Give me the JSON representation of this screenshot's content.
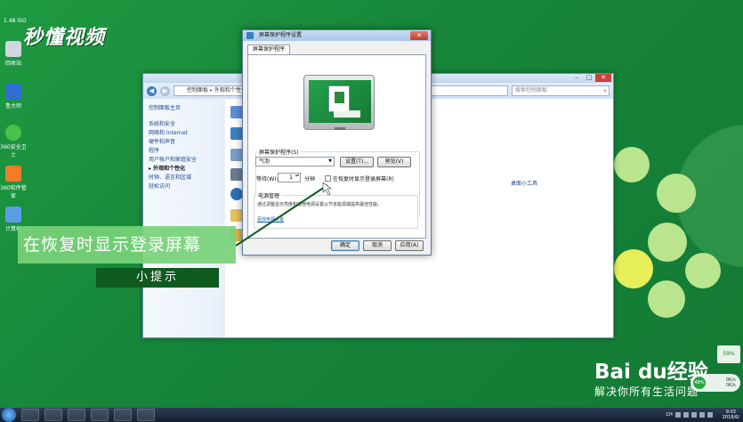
{
  "watermark": "秒懂视频",
  "top_number": "1.48 ISO",
  "desktop_icons": [
    {
      "name": "recycle-bin",
      "label": "回收站",
      "color": "#cfd8e0"
    },
    {
      "name": "app-2",
      "label": "鲁大师",
      "color": "#2f6fd1"
    },
    {
      "name": "app-3",
      "label": "360安全卫士",
      "color": "#49c14a"
    },
    {
      "name": "app-4",
      "label": "360软件管家",
      "color": "#f47b2a"
    },
    {
      "name": "app-5",
      "label": "计算机",
      "color": "#5c9ee6"
    }
  ],
  "control_panel": {
    "address": [
      "控制面板",
      "外观和个性化"
    ],
    "search_placeholder": "搜索控制面板",
    "left_nav": [
      {
        "label": "控制面板主页",
        "head": true
      },
      {
        "label": "系统和安全"
      },
      {
        "label": "网络和 Internet"
      },
      {
        "label": "硬件和声音"
      },
      {
        "label": "程序"
      },
      {
        "label": "用户帐户和家庭安全"
      },
      {
        "label": "外观和个性化",
        "current": true
      },
      {
        "label": "时钟、语言和区域"
      },
      {
        "label": "轻松访问"
      }
    ],
    "right_link": "桌面小工具"
  },
  "dialog": {
    "title": "屏幕保护程序设置",
    "close": "✕",
    "tab": "屏幕保护程序",
    "screensaver_group_label": "屏幕保护程序(S)",
    "screensaver_value": "气泡",
    "settings_button": "设置(T)...",
    "preview_button": "预览(V)",
    "wait_label": "等待(W):",
    "wait_value": "1",
    "wait_unit": "分钟",
    "resume_checkbox_label": "在恢复时显示登录屏幕(R)",
    "power_group_label": "电源管理",
    "power_desc": "通过调整显示亮度和其他电源设置以节省能源或提供最佳性能。",
    "power_link": "更改电源设置",
    "ok_button": "确定",
    "cancel_button": "取消",
    "apply_button": "应用(A)"
  },
  "caption": "在恢复时显示登录屏幕",
  "tip": "小提示",
  "baidu": {
    "logo": "Bai du经验",
    "slogan": "解决你所有生活问题"
  },
  "gauge": "59%",
  "network": {
    "percent": "48%",
    "up": "0K/s",
    "down": "0K/s"
  },
  "taskbar": {
    "lang": "CH",
    "time": "9:03",
    "date": "2018/6/"
  }
}
